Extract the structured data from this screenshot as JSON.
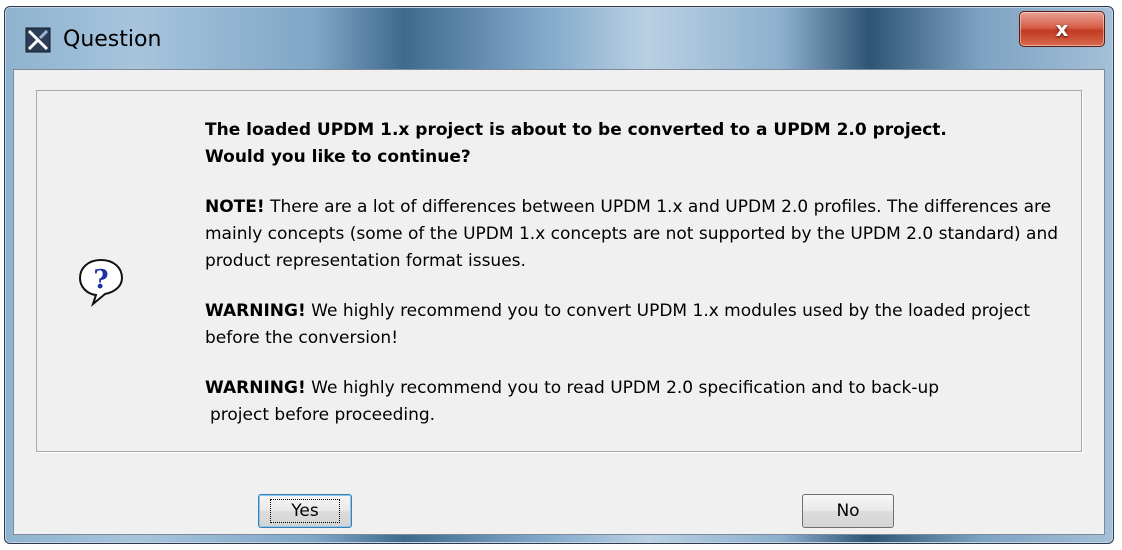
{
  "window": {
    "title": "Question",
    "close_label": "x"
  },
  "message": {
    "headline_line1": "The loaded UPDM 1.x project is about to be converted to a UPDM 2.0 project.",
    "headline_line2": "Would you like to continue?",
    "note_label": "NOTE!",
    "note_text": " There are a lot of differences between UPDM 1.x and UPDM 2.0 profiles. The differences are mainly concepts (some of the UPDM 1.x concepts are not supported by the UPDM 2.0 standard) and product representation format issues.",
    "warning1_label": "WARNING!",
    "warning1_text": " We highly recommend you to convert UPDM 1.x modules used by the loaded project before the conversion!",
    "warning2_label": "WARNING!",
    "warning2_text": " We highly recommend you to read UPDM 2.0 specification and to back-up",
    "warning2_text_line2": "project before proceeding."
  },
  "buttons": {
    "yes_label": "Yes",
    "no_label": "No"
  },
  "icons": {
    "app": "magicdraw-app-icon",
    "message": "question-icon",
    "close": "close-icon"
  },
  "colors": {
    "close_button": "#c94a30",
    "dialog_background": "#f0f0f0",
    "question_mark": "#1f2fa8"
  }
}
